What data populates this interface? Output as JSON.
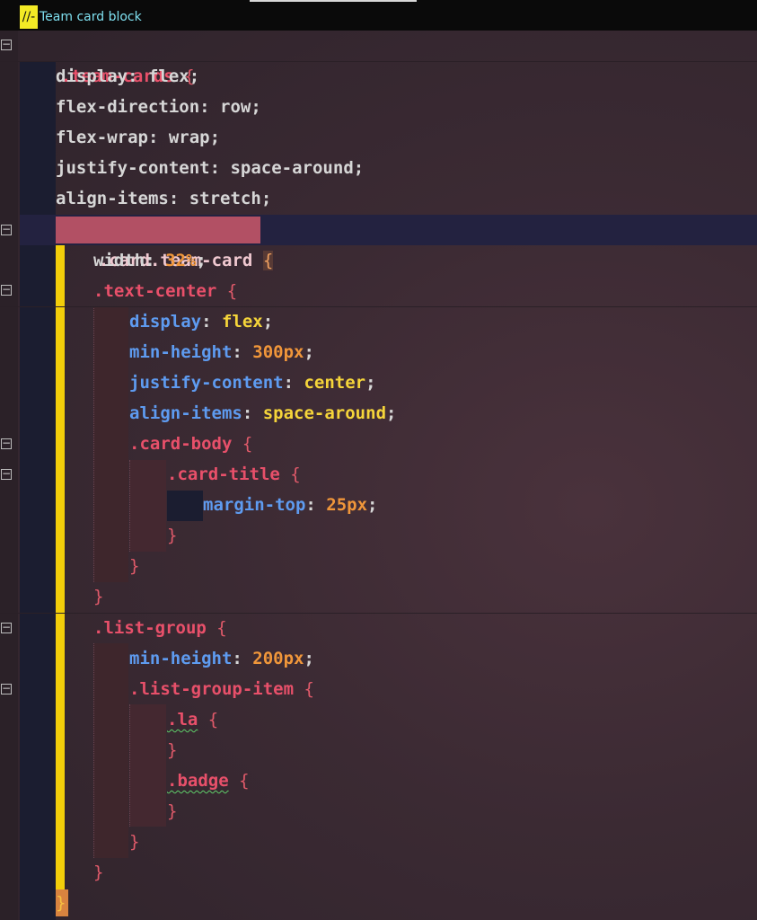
{
  "header": {
    "marker": "//-",
    "title": "Team card block"
  },
  "code": {
    "l1_sel": ".team-cards",
    "open": "{",
    "close": "}",
    "l2_prop": "display",
    "l2_val": "flex",
    "l3_prop": "flex-direction",
    "l3_val": "row",
    "l4_prop": "flex-wrap",
    "l4_val": "wrap",
    "l5_prop": "justify-content",
    "l5_val": "space-around",
    "l6_prop": "align-items",
    "l6_val": "stretch",
    "l7_sel": ".card.team-card",
    "l8_prop": "width",
    "l8_val": "32%",
    "l9_sel": ".text-center",
    "l10_prop": "display",
    "l10_val": "flex",
    "l11_prop": "min-height",
    "l11_val": "300px",
    "l12_prop": "justify-content",
    "l12_val": "center",
    "l13_prop": "align-items",
    "l13_val": "space-around",
    "l14_sel": ".card-body",
    "l15_sel": ".card-title",
    "l16_prop": "margin-top",
    "l16_val": "25px",
    "l21_sel": ".list-group",
    "l22_prop": "min-height",
    "l22_val": "200px",
    "l23_sel": ".list-group-item",
    "l24_sel": ".la",
    "l26_sel": ".badge"
  },
  "colors": {
    "selector": "#e8506a",
    "property_plain": "#d6d6d6",
    "property_nested": "#5e9bf0",
    "value_keyword": "#f5d53a",
    "value_number": "#f0963a",
    "level_bar": "#f2ce0a",
    "comment": "#7fe0f0"
  },
  "icons": {
    "fold": "collapse-minus-icon"
  }
}
